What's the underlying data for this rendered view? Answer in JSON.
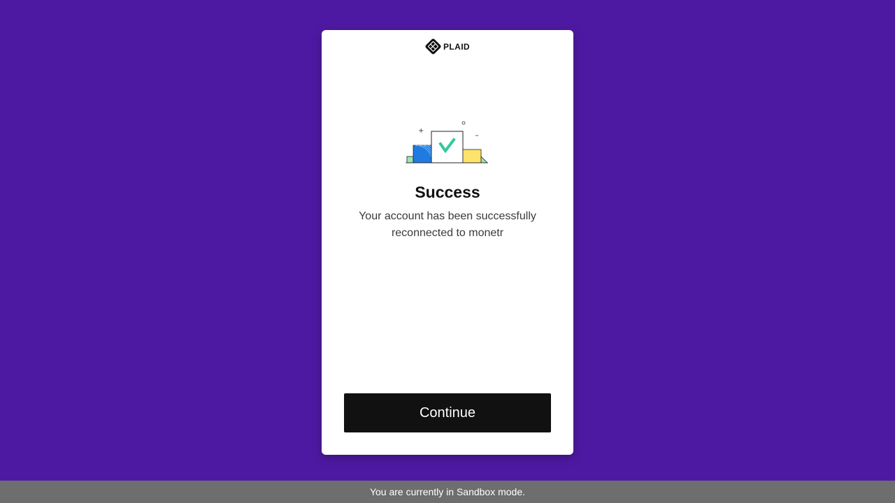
{
  "brand": {
    "logo_text": "PLAID",
    "logo_icon": "plaid-logo-icon"
  },
  "illustration": {
    "icon": "success-illustration",
    "colors": {
      "blue": "#1f7be0",
      "green_check": "#2fc99d",
      "yellow": "#fde36b",
      "mint": "#9fe3b8"
    }
  },
  "content": {
    "title": "Success",
    "message": "Your account has been successfully reconnected to monetr"
  },
  "actions": {
    "continue_label": "Continue"
  },
  "footer": {
    "sandbox_text": "You are currently in Sandbox mode."
  },
  "colors": {
    "background": "#4e19a2",
    "card": "#ffffff",
    "button": "#111111",
    "footer_bar": "#6e6e6e"
  }
}
